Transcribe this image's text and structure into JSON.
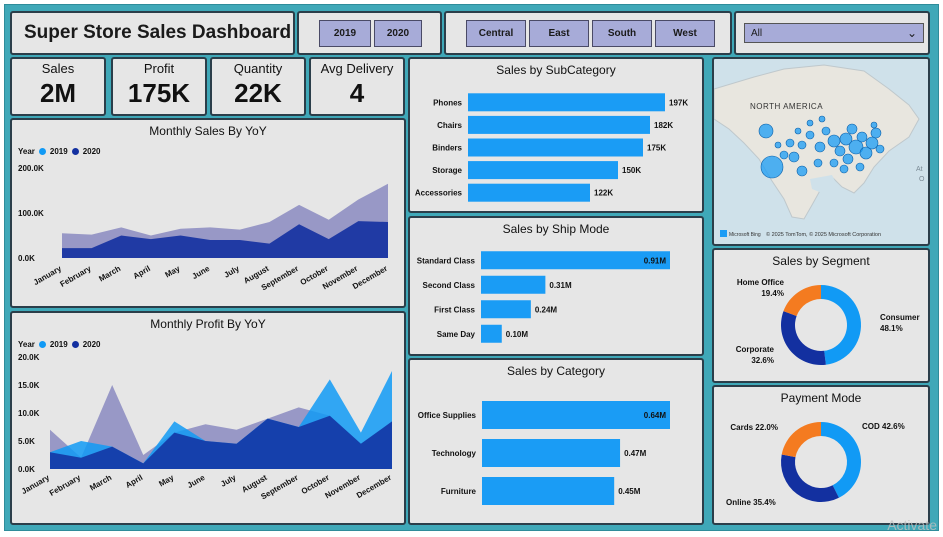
{
  "header": {
    "title": "Super Store Sales Dashboard",
    "years": [
      "2019",
      "2020"
    ],
    "regions": [
      "Central",
      "East",
      "South",
      "West"
    ],
    "dropdown_value": "All"
  },
  "kpis": [
    {
      "label": "Sales",
      "value": "2M"
    },
    {
      "label": "Profit",
      "value": "175K"
    },
    {
      "label": "Quantity",
      "value": "22K"
    },
    {
      "label": "Avg Delivery",
      "value": "4"
    }
  ],
  "colors": {
    "c2019": "#119af5",
    "c2020": "#1330a0",
    "bar": "#1a9cf5",
    "orange": "#f47b20",
    "area2019": "#8a8ac0"
  },
  "map": {
    "label": "NORTH AMERICA",
    "side_label": "At",
    "side_label2": "O",
    "credit": "© 2025 TomTom, © 2025 Microsoft Corporation",
    "brand": "Microsoft Bing"
  },
  "watermark": "Activate",
  "chart_data": [
    {
      "type": "area",
      "title": "Monthly Sales By YoY",
      "legend_title": "Year",
      "legend": "top-left",
      "categories": [
        "January",
        "February",
        "March",
        "April",
        "May",
        "June",
        "July",
        "August",
        "September",
        "October",
        "November",
        "December"
      ],
      "yticks": [
        "200.0K",
        "100.0K",
        "0.0K"
      ],
      "ylim": [
        0,
        200000
      ],
      "series": [
        {
          "name": "2019",
          "values": [
            55000,
            52000,
            68000,
            50000,
            65000,
            68000,
            63000,
            80000,
            118000,
            85000,
            130000,
            165000
          ]
        },
        {
          "name": "2020",
          "values": [
            22000,
            22000,
            50000,
            42000,
            50000,
            40000,
            40000,
            32000,
            75000,
            42000,
            82000,
            80000
          ]
        }
      ]
    },
    {
      "type": "area",
      "title": "Monthly Profit By YoY",
      "legend_title": "Year",
      "legend": "top-left",
      "categories": [
        "January",
        "February",
        "March",
        "April",
        "May",
        "June",
        "July",
        "August",
        "September",
        "October",
        "November",
        "December"
      ],
      "yticks": [
        "20.0K",
        "15.0K",
        "10.0K",
        "5.0K",
        "0.0K"
      ],
      "ylim": [
        0,
        20000
      ],
      "series": [
        {
          "name": "2019",
          "values": [
            3000,
            5000,
            4000,
            1000,
            8500,
            5000,
            4500,
            9000,
            7500,
            16000,
            6500,
            17500
          ]
        },
        {
          "name": "2020",
          "values": [
            7000,
            2000,
            15000,
            2500,
            6500,
            8000,
            7000,
            9000,
            11000,
            9500,
            4500,
            8500
          ]
        }
      ]
    },
    {
      "type": "bar",
      "title": "Sales by SubCategory",
      "categories": [
        "Phones",
        "Chairs",
        "Binders",
        "Storage",
        "Accessories"
      ],
      "values": [
        197,
        182,
        175,
        150,
        122
      ],
      "labels": [
        "197K",
        "182K",
        "175K",
        "150K",
        "122K"
      ],
      "xlim": [
        0,
        197
      ]
    },
    {
      "type": "bar",
      "title": "Sales by Ship Mode",
      "categories": [
        "Standard Class",
        "Second Class",
        "First Class",
        "Same Day"
      ],
      "values": [
        0.91,
        0.31,
        0.24,
        0.1
      ],
      "labels": [
        "0.91M",
        "0.31M",
        "0.24M",
        "0.10M"
      ],
      "xlim": [
        0,
        0.91
      ]
    },
    {
      "type": "bar",
      "title": "Sales by Category",
      "categories": [
        "Office Supplies",
        "Technology",
        "Furniture"
      ],
      "values": [
        0.64,
        0.47,
        0.45
      ],
      "labels": [
        "0.64M",
        "0.47M",
        "0.45M"
      ],
      "xlim": [
        0,
        0.64
      ]
    },
    {
      "type": "pie",
      "title": "Sales by Segment",
      "categories": [
        "Consumer",
        "Corporate",
        "Home Office"
      ],
      "values": [
        48.1,
        32.6,
        19.4
      ],
      "labels": [
        "48.1%",
        "32.6%",
        "19.4%"
      ],
      "colors": [
        "#119af5",
        "#1330a0",
        "#f47b20"
      ]
    },
    {
      "type": "pie",
      "title": "Payment Mode",
      "categories": [
        "COD",
        "Online",
        "Cards"
      ],
      "values": [
        42.6,
        35.4,
        22.0
      ],
      "labels": [
        "COD 42.6%",
        "Online 35.4%",
        "Cards 22.0%"
      ],
      "colors": [
        "#119af5",
        "#1330a0",
        "#f47b20"
      ]
    }
  ]
}
